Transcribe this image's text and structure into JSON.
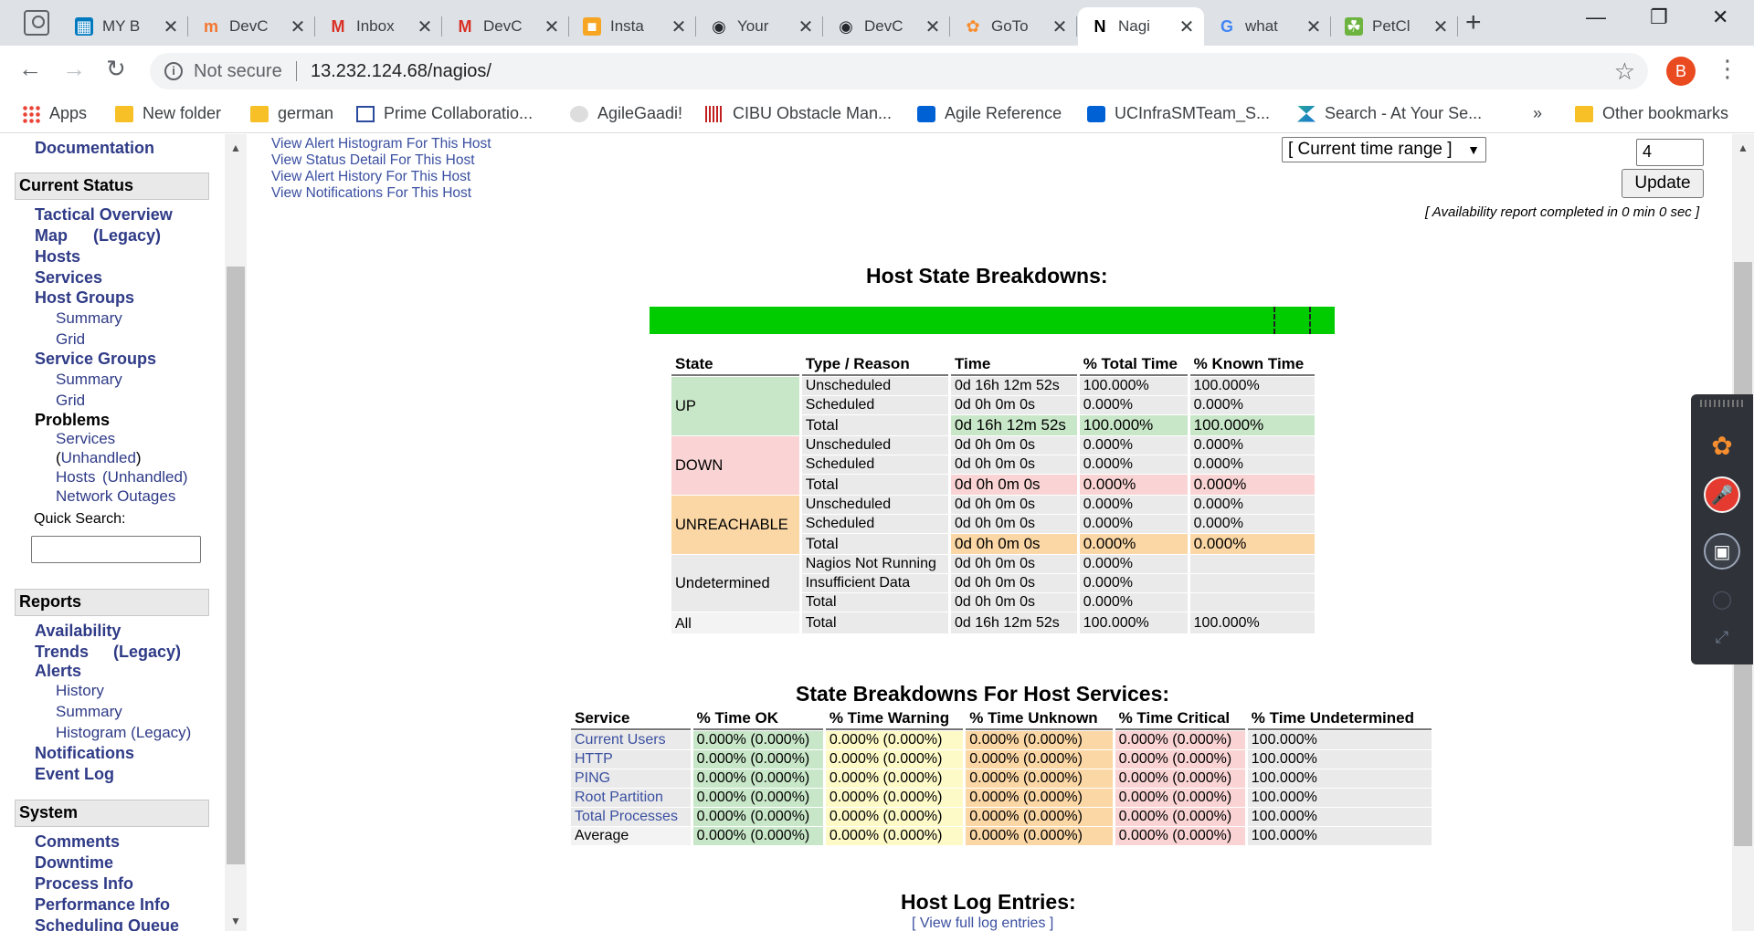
{
  "browser": {
    "tabs": [
      {
        "title": "MY B",
        "icon": "trello-icon",
        "active": false
      },
      {
        "title": "DevC",
        "icon": "jira-icon",
        "active": false
      },
      {
        "title": "Inbox",
        "icon": "gmail-icon",
        "active": false
      },
      {
        "title": "DevC",
        "icon": "gmail-icon",
        "active": false
      },
      {
        "title": "Insta",
        "icon": "aws-box-icon",
        "active": false
      },
      {
        "title": "Your",
        "icon": "github-icon",
        "active": false
      },
      {
        "title": "DevC",
        "icon": "github-icon",
        "active": false
      },
      {
        "title": "GoTo",
        "icon": "gotomeeting-icon",
        "active": false
      },
      {
        "title": "Nagi",
        "icon": "nagios-icon",
        "active": true
      },
      {
        "title": "what",
        "icon": "google-icon",
        "active": false
      },
      {
        "title": "PetCl",
        "icon": "spring-icon",
        "active": false
      }
    ],
    "security_label": "Not secure",
    "url": "13.232.124.68/nagios/",
    "profile_initial": "B",
    "bookmarks": [
      {
        "label": "Apps",
        "icon": "apps-grid-icon"
      },
      {
        "label": "New folder",
        "icon": "folder-icon"
      },
      {
        "label": "german",
        "icon": "folder-icon"
      },
      {
        "label": "Prime Collaboratio...",
        "icon": "prime-icon"
      },
      {
        "label": "AgileGaadi!",
        "icon": "agile-icon"
      },
      {
        "label": "CIBU Obstacle Man...",
        "icon": "cisco-icon"
      },
      {
        "label": "Agile Reference",
        "icon": "box-icon"
      },
      {
        "label": "UCInfraSMTeam_S...",
        "icon": "box-icon"
      },
      {
        "label": "Search - At Your Se...",
        "icon": "confluence-icon"
      }
    ],
    "overflow": "»",
    "other_bookmarks": "Other bookmarks"
  },
  "sidebar": {
    "documentation": "Documentation",
    "current_status": "Current Status",
    "tactical_overview": "Tactical Overview",
    "map": "Map",
    "map_legacy": "(Legacy)",
    "hosts": "Hosts",
    "services": "Services",
    "host_groups": "Host Groups",
    "hg_summary": "Summary",
    "hg_grid": "Grid",
    "service_groups": "Service Groups",
    "sg_summary": "Summary",
    "sg_grid": "Grid",
    "problems": "Problems",
    "prob_services": "Services",
    "prob_unhandled1_open": "(",
    "prob_unhandled1": "Unhandled",
    "prob_unhandled1_close": ")",
    "prob_hosts": "Hosts",
    "prob_unhandled2": "(Unhandled)",
    "network_outages": "Network Outages",
    "quick_search": "Quick Search:",
    "reports": "Reports",
    "availability": "Availability",
    "trends": "Trends",
    "trends_legacy": "(Legacy)",
    "alerts": "Alerts",
    "alerts_history": "History",
    "alerts_summary": "Summary",
    "alerts_histogram": "Histogram (Legacy)",
    "notifications": "Notifications",
    "event_log": "Event Log",
    "system": "System",
    "comments": "Comments",
    "downtime": "Downtime",
    "process_info": "Process Info",
    "performance_info": "Performance Info",
    "scheduling_queue": "Scheduling Queue"
  },
  "main": {
    "host_links": [
      "View Alert Histogram For This Host",
      "View Status Detail For This Host",
      "View Alert History For This Host",
      "View Notifications For This Host"
    ],
    "time_range": "[ Current time range ]",
    "assume_value": "4",
    "update_label": "Update",
    "report_note": "[ Availability report completed in 0 min 0 sec ]",
    "host_state_title": "Host State Breakdowns:",
    "state_bar_colors": {
      "up": "#00cc00"
    },
    "host_table": {
      "headers": [
        "State",
        "Type / Reason",
        "Time",
        "% Total Time",
        "% Known Time"
      ],
      "groups": [
        {
          "state": "UP",
          "rows": [
            [
              "Unscheduled",
              "0d 16h 12m 52s",
              "100.000%",
              "100.000%"
            ],
            [
              "Scheduled",
              "0d 0h 0m 0s",
              "0.000%",
              "0.000%"
            ],
            [
              "Total",
              "0d 16h 12m 52s",
              "100.000%",
              "100.000%"
            ]
          ]
        },
        {
          "state": "DOWN",
          "rows": [
            [
              "Unscheduled",
              "0d 0h 0m 0s",
              "0.000%",
              "0.000%"
            ],
            [
              "Scheduled",
              "0d 0h 0m 0s",
              "0.000%",
              "0.000%"
            ],
            [
              "Total",
              "0d 0h 0m 0s",
              "0.000%",
              "0.000%"
            ]
          ]
        },
        {
          "state": "UNREACHABLE",
          "rows": [
            [
              "Unscheduled",
              "0d 0h 0m 0s",
              "0.000%",
              "0.000%"
            ],
            [
              "Scheduled",
              "0d 0h 0m 0s",
              "0.000%",
              "0.000%"
            ],
            [
              "Total",
              "0d 0h 0m 0s",
              "0.000%",
              "0.000%"
            ]
          ]
        },
        {
          "state": "Undetermined",
          "rows": [
            [
              "Nagios Not Running",
              "0d 0h 0m 0s",
              "0.000%",
              ""
            ],
            [
              "Insufficient Data",
              "0d 0h 0m 0s",
              "0.000%",
              ""
            ],
            [
              "Total",
              "0d 0h 0m 0s",
              "0.000%",
              ""
            ]
          ]
        }
      ],
      "all_row": [
        "All",
        "Total",
        "0d 16h 12m 52s",
        "100.000%",
        "100.000%"
      ]
    },
    "services_title": "State Breakdowns For Host Services:",
    "services_table": {
      "headers": [
        "Service",
        "% Time OK",
        "% Time Warning",
        "% Time Unknown",
        "% Time Critical",
        "% Time Undetermined"
      ],
      "rows": [
        [
          "Current Users",
          "0.000% (0.000%)",
          "0.000% (0.000%)",
          "0.000% (0.000%)",
          "0.000% (0.000%)",
          "100.000%"
        ],
        [
          "HTTP",
          "0.000% (0.000%)",
          "0.000% (0.000%)",
          "0.000% (0.000%)",
          "0.000% (0.000%)",
          "100.000%"
        ],
        [
          "PING",
          "0.000% (0.000%)",
          "0.000% (0.000%)",
          "0.000% (0.000%)",
          "0.000% (0.000%)",
          "100.000%"
        ],
        [
          "Root Partition",
          "0.000% (0.000%)",
          "0.000% (0.000%)",
          "0.000% (0.000%)",
          "0.000% (0.000%)",
          "100.000%"
        ],
        [
          "Total Processes",
          "0.000% (0.000%)",
          "0.000% (0.000%)",
          "0.000% (0.000%)",
          "0.000% (0.000%)",
          "100.000%"
        ]
      ],
      "average_row": [
        "Average",
        "0.000% (0.000%)",
        "0.000% (0.000%)",
        "0.000% (0.000%)",
        "0.000% (0.000%)",
        "100.000%"
      ]
    },
    "log_title": "Host Log Entries:",
    "log_link": "[ View full log entries ]"
  },
  "side_panel": {
    "buttons": [
      "gotomeeting-icon",
      "mic-muted-icon",
      "screen-share-icon",
      "chat-icon",
      "collapse-icon"
    ]
  }
}
